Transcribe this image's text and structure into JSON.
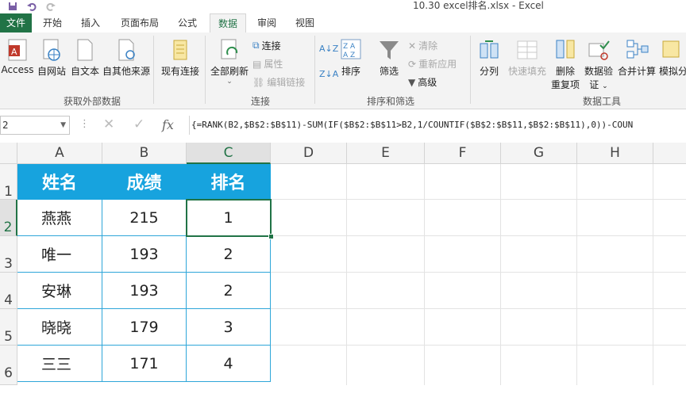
{
  "window": {
    "title": "10.30 excel排名.xlsx - Excel"
  },
  "tabs": [
    {
      "label": "文件"
    },
    {
      "label": "开始"
    },
    {
      "label": "插入"
    },
    {
      "label": "页面布局"
    },
    {
      "label": "公式"
    },
    {
      "label": "数据"
    },
    {
      "label": "审阅"
    },
    {
      "label": "视图"
    }
  ],
  "ribbon": {
    "get_external": {
      "label": "获取外部数据",
      "access": "Access",
      "web": "自网站",
      "text": "自文本",
      "other": "自其他来源",
      "existing": "现有连接"
    },
    "connections": {
      "label": "连接",
      "refresh_all": "全部刷新",
      "connections": "连接",
      "properties": "属性",
      "edit_links": "编辑链接"
    },
    "sort_filter": {
      "label": "排序和筛选",
      "sort": "排序",
      "filter": "筛选",
      "clear": "清除",
      "reapply": "重新应用",
      "advanced": "高级"
    },
    "data_tools": {
      "label": "数据工具",
      "text_to_columns": "分列",
      "flash_fill": "快速填充",
      "remove_dup_1": "删除",
      "remove_dup_2": "重复项",
      "validation_1": "数据验",
      "validation_2": "证",
      "consolidate": "合并计算",
      "what_if": "模拟分"
    }
  },
  "formula_bar": {
    "name_box": "2",
    "fx": "fx",
    "formula": "{=RANK(B2,$B$2:$B$11)-SUM(IF($B$2:$B$11>B2,1/COUNTIF($B$2:$B$11,$B$2:$B$11),0))-COUN"
  },
  "grid": {
    "columns": [
      "A",
      "B",
      "C",
      "D",
      "E",
      "F",
      "G",
      "H"
    ],
    "rows": [
      "1",
      "2",
      "3",
      "4",
      "5",
      "6"
    ],
    "header": [
      "姓名",
      "成绩",
      "排名"
    ],
    "data": [
      [
        "燕燕",
        "215",
        "1"
      ],
      [
        "唯一",
        "193",
        "2"
      ],
      [
        "安琳",
        "193",
        "2"
      ],
      [
        "晓晓",
        "179",
        "3"
      ],
      [
        "三三",
        "171",
        "4"
      ]
    ]
  },
  "colors": {
    "excel_green": "#217346",
    "table_header": "#17a3de",
    "table_border": "#2ea6d9"
  }
}
